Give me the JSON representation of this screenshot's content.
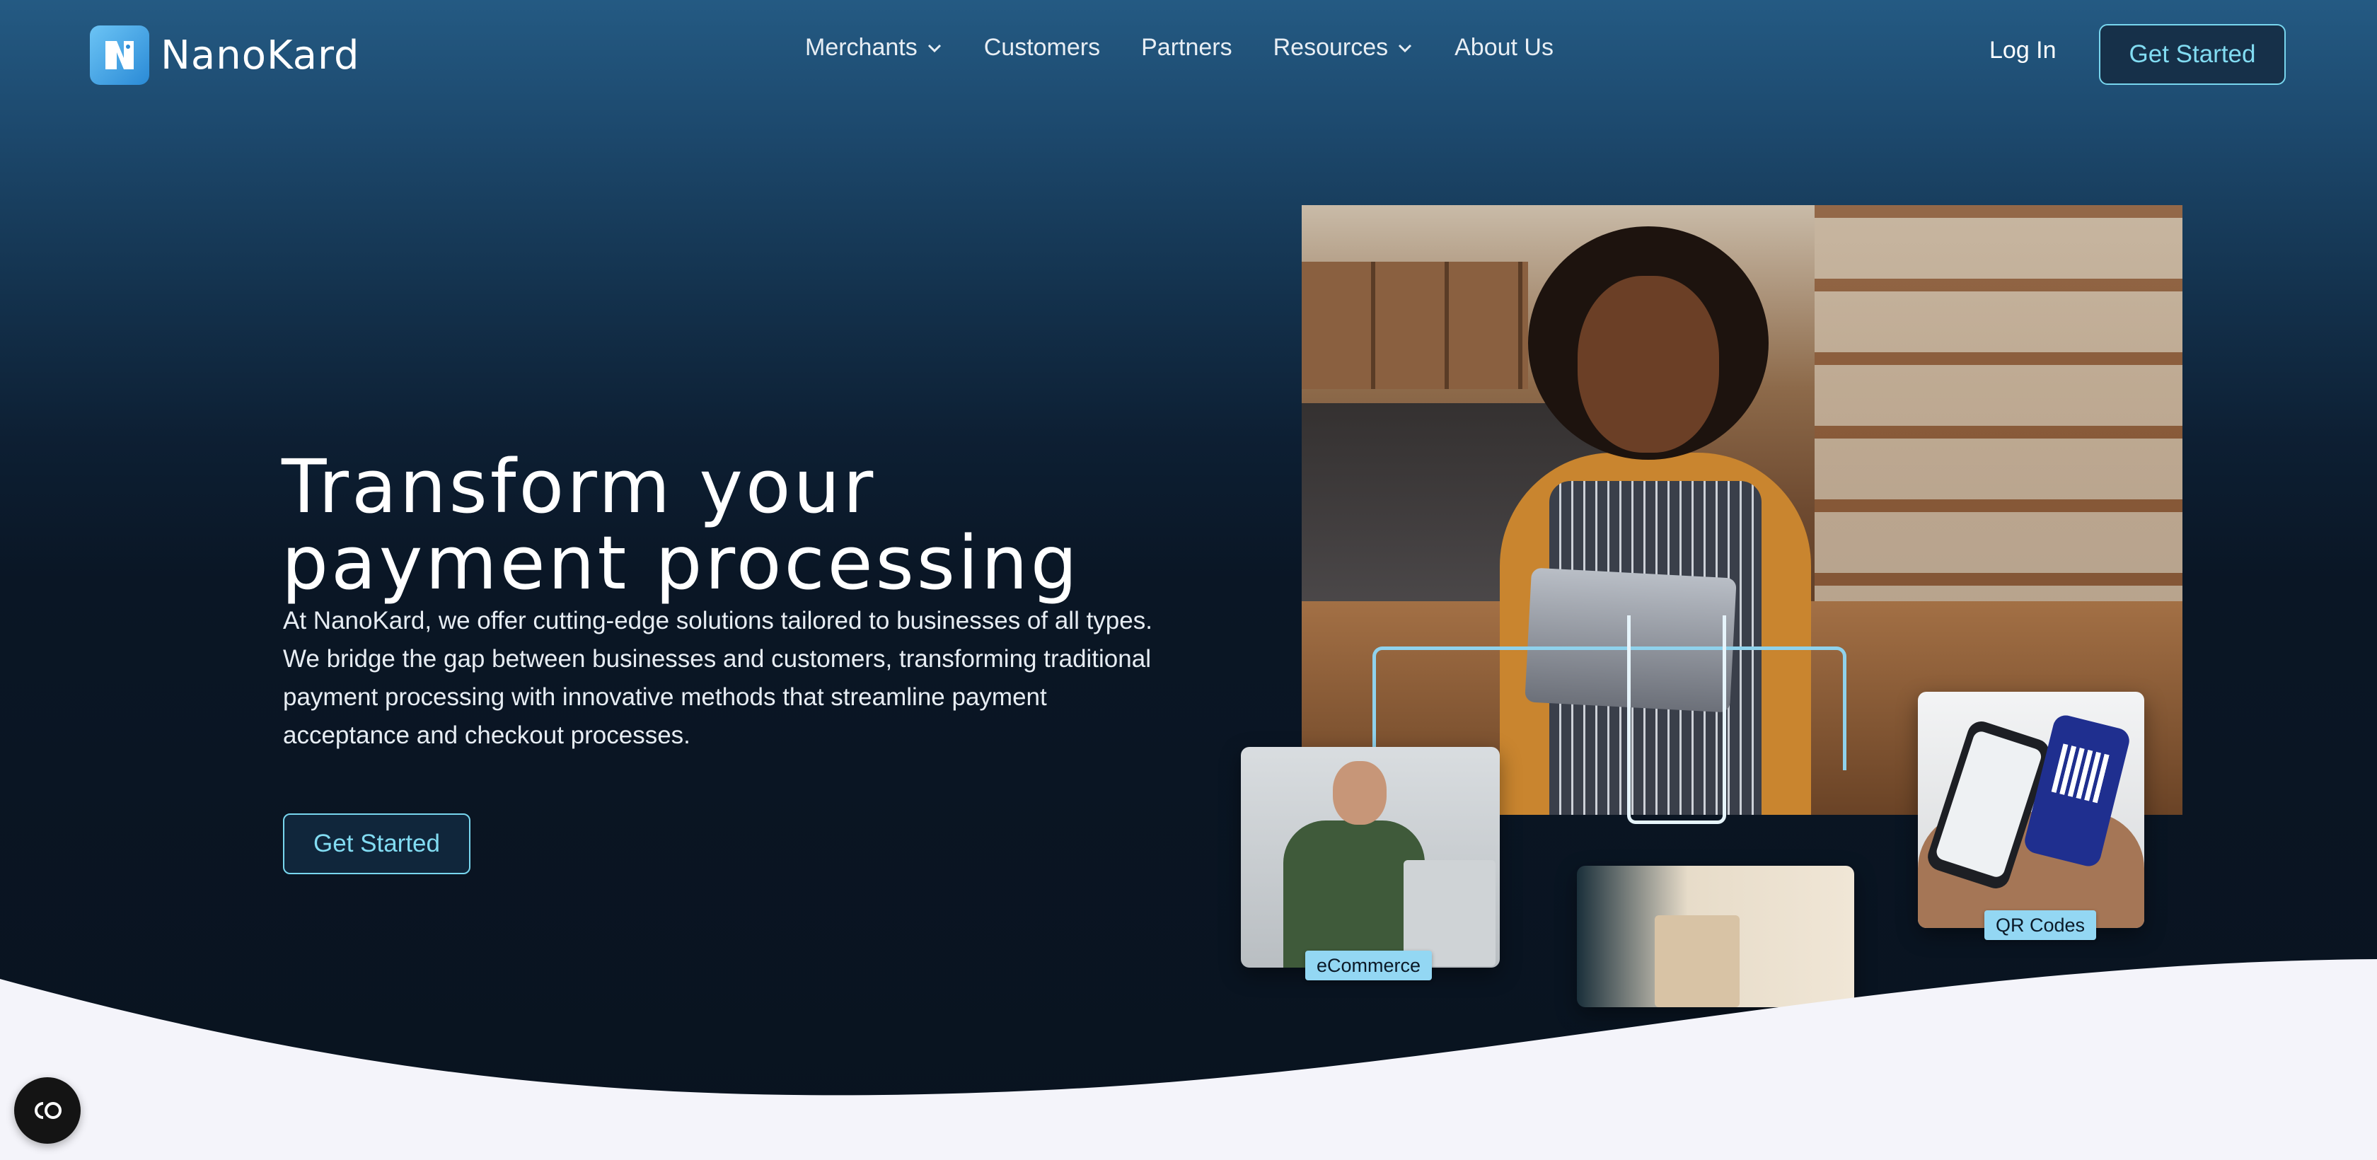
{
  "brand": {
    "name": "NanoKard",
    "logo_icon": "nanokard-logo-icon",
    "accent": "#78d6ee"
  },
  "nav": {
    "items": [
      {
        "label": "Merchants",
        "dropdown": true
      },
      {
        "label": "Customers",
        "dropdown": false
      },
      {
        "label": "Partners",
        "dropdown": false
      },
      {
        "label": "Resources",
        "dropdown": true
      },
      {
        "label": "About Us",
        "dropdown": false
      }
    ],
    "login_label": "Log In",
    "cta_label": "Get Started"
  },
  "hero": {
    "title_line1": "Transform your",
    "title_line2": "payment processing",
    "body": "At NanoKard, we offer cutting-edge solutions tailored to businesses of all types. We bridge the gap between businesses and customers, transforming traditional payment processing with innovative methods that streamline payment acceptance and checkout processes.",
    "cta_label": "Get Started"
  },
  "images": {
    "main_alt": "barista-with-tablet-image",
    "cards": [
      {
        "tag": "eCommerce",
        "image": "shopper-with-laptop-image"
      },
      {
        "tag": "",
        "image": "in-store-shopping-image"
      },
      {
        "tag": "QR Codes",
        "image": "qr-code-phones-image"
      }
    ]
  },
  "colors": {
    "background_top": "#245a83",
    "background_bottom": "#09131f",
    "wave": "#f4f4fa",
    "tag": "#93d7f3"
  },
  "privacy": {
    "icon": "privacy-settings-icon"
  }
}
